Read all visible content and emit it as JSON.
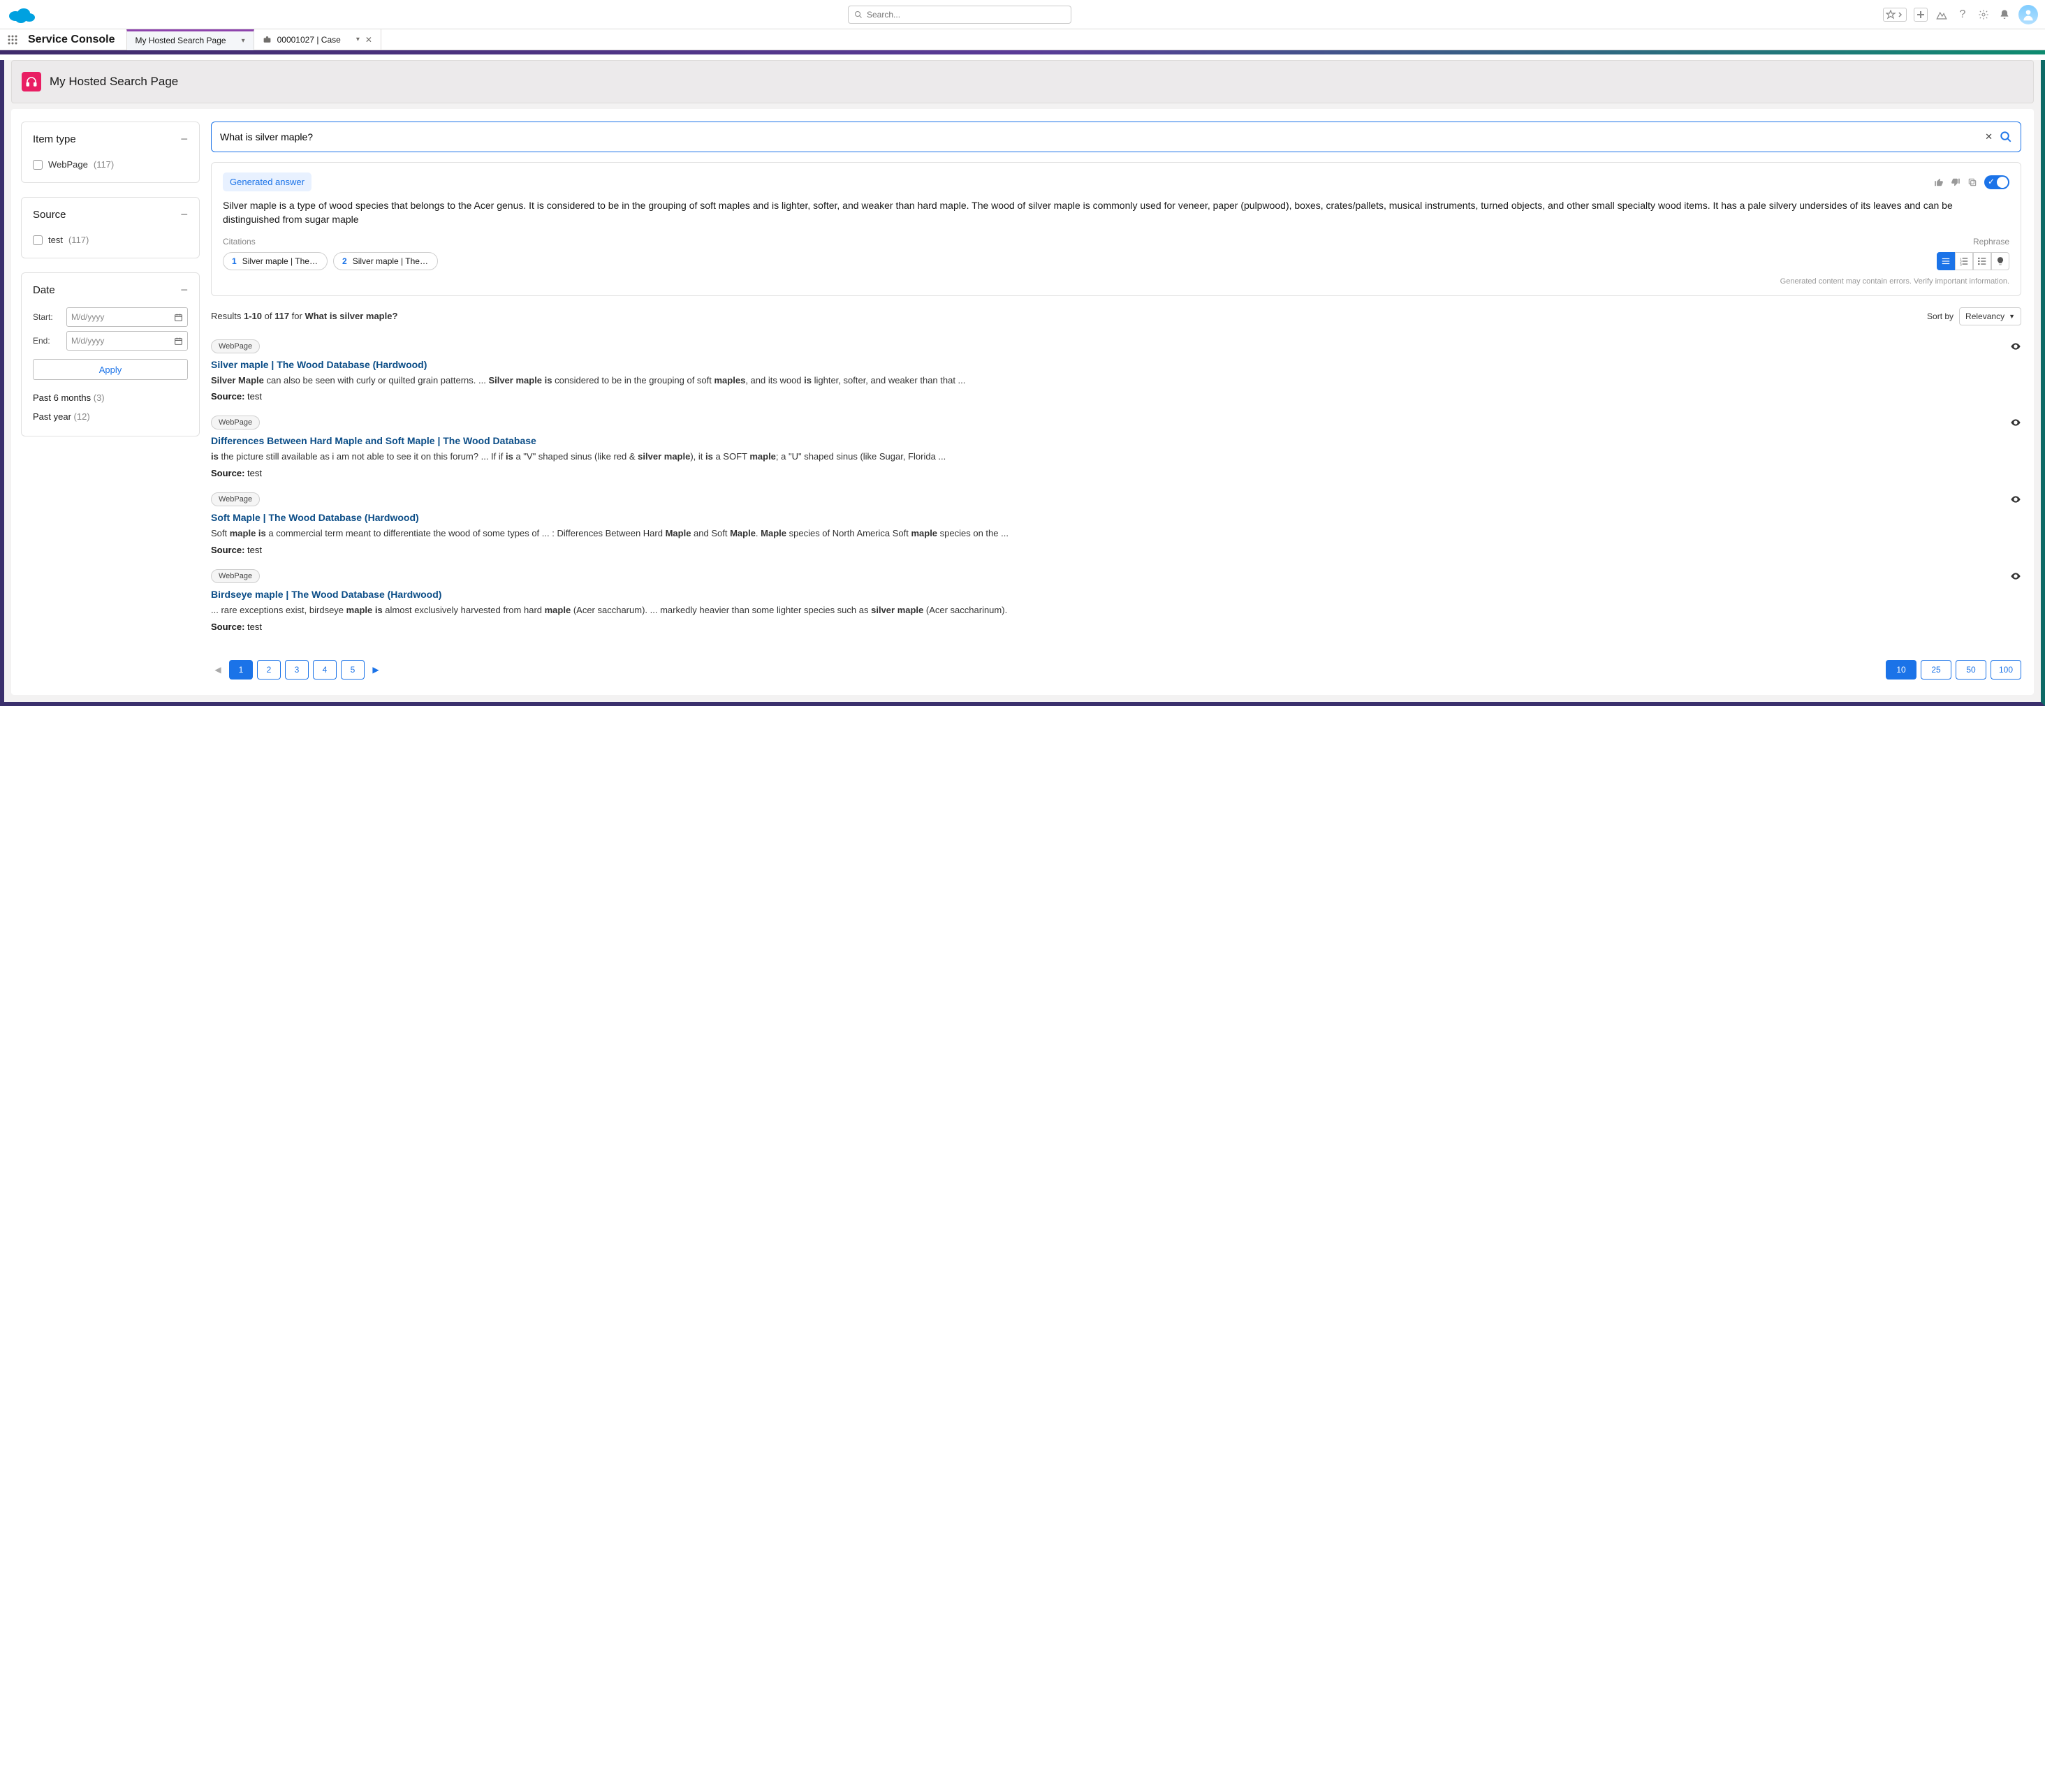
{
  "topbar": {
    "global_search_placeholder": "Search...",
    "avatar_alt": "User avatar"
  },
  "appnav": {
    "app_name": "Service Console",
    "tabs": [
      {
        "label": "My Hosted Search Page",
        "active": true,
        "closeable": false,
        "has_caret": true
      },
      {
        "label": "00001027 | Case",
        "active": false,
        "closeable": true,
        "has_caret": true,
        "icon": "briefcase"
      }
    ]
  },
  "page": {
    "title": "My Hosted Search Page"
  },
  "facets": {
    "item_type": {
      "title": "Item type",
      "options": [
        {
          "label": "WebPage",
          "count": "(117)"
        }
      ]
    },
    "source": {
      "title": "Source",
      "options": [
        {
          "label": "test",
          "count": "(117)"
        }
      ]
    },
    "date": {
      "title": "Date",
      "start_label": "Start:",
      "end_label": "End:",
      "placeholder": "M/d/yyyy",
      "apply_label": "Apply",
      "quick": [
        {
          "label": "Past 6 months",
          "count": "(3)"
        },
        {
          "label": "Past year",
          "count": "(12)"
        }
      ]
    }
  },
  "search": {
    "value": "What is silver maple?"
  },
  "generated": {
    "badge": "Generated answer",
    "text": "Silver maple is a type of wood species that belongs to the Acer genus. It is considered to be in the grouping of soft maples and is lighter, softer, and weaker than hard maple. The wood of silver maple is commonly used for veneer, paper (pulpwood), boxes, crates/pallets, musical instruments, turned objects, and other small specialty wood items. It has a pale silvery undersides of its leaves and can be distinguished from sugar maple",
    "citations_label": "Citations",
    "citations": [
      {
        "num": "1",
        "label": "Silver maple | The ..."
      },
      {
        "num": "2",
        "label": "Silver maple | The ..."
      }
    ],
    "rephrase_label": "Rephrase",
    "disclaimer": "Generated content may contain errors. Verify important information."
  },
  "results_meta": {
    "prefix": "Results ",
    "range": "1-10",
    "of": " of ",
    "total": "117",
    "for": " for ",
    "query": "What is silver maple?",
    "sort_label": "Sort by",
    "sort_value": "Relevancy"
  },
  "results": [
    {
      "badge": "WebPage",
      "title_html": "Silver <b>maple</b> | The Wood Database (Hardwood)",
      "snippet_html": "<b>Silver Maple</b> can also be seen with curly or quilted grain patterns. ... <b>Silver maple is</b> considered to be in the grouping of soft <b>maples</b>, and its wood <b>is</b> lighter, softer, and weaker than that ...",
      "source_label": "Source:",
      "source_value": "test"
    },
    {
      "badge": "WebPage",
      "title_html": "Differences Between Hard <b>Maple</b> and Soft <b>Maple</b> | The Wood Database",
      "snippet_html": "<b>is</b> the picture still available as i am not able to see it on this forum? ... If if <b>is</b> a \"V\" shaped sinus (like red & <b>silver maple</b>), it <b>is</b> a SOFT <b>maple</b>; a \"U\" shaped sinus (like Sugar, Florida ...",
      "source_label": "Source:",
      "source_value": "test"
    },
    {
      "badge": "WebPage",
      "title_html": "Soft <b>Maple</b> | The Wood Database (Hardwood)",
      "snippet_html": "Soft <b>maple is</b> a commercial term meant to differentiate the wood of some types of ... : Differences Between Hard <b>Maple</b> and Soft <b>Maple</b>. <b>Maple</b> species of North America Soft <b>maple</b> species on the ...",
      "source_label": "Source:",
      "source_value": "test"
    },
    {
      "badge": "WebPage",
      "title_html": "Birdseye <b>maple</b> | The Wood Database (Hardwood)",
      "snippet_html": "... rare exceptions exist, birdseye <b>maple is</b> almost exclusively harvested from hard <b>maple</b> (Acer saccharum). ... markedly heavier than some lighter species such as <b>silver maple</b> (Acer saccharinum).",
      "source_label": "Source:",
      "source_value": "test"
    }
  ],
  "pagination": {
    "pages": [
      "1",
      "2",
      "3",
      "4",
      "5"
    ],
    "active": "1",
    "page_sizes": [
      "10",
      "25",
      "50",
      "100"
    ],
    "active_size": "10"
  }
}
